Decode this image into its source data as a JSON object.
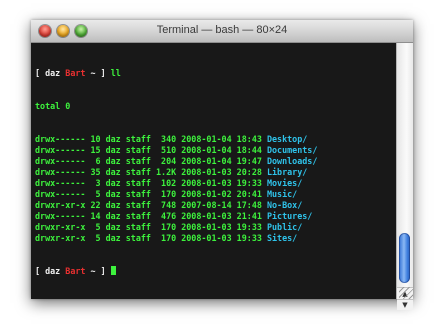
{
  "window": {
    "title": "Terminal — bash — 80×24"
  },
  "prompt": {
    "open": "[",
    "user": "daz",
    "host": "Bart",
    "path": "~",
    "close": "]"
  },
  "command": "ll",
  "total_line": "total 0",
  "listing": [
    {
      "perms": "drwx------",
      "links": "10",
      "user": "daz",
      "group": "staff",
      "size": "340",
      "date": "2008-01-04",
      "time": "18:43",
      "name": "Desktop/"
    },
    {
      "perms": "drwx------",
      "links": "15",
      "user": "daz",
      "group": "staff",
      "size": "510",
      "date": "2008-01-04",
      "time": "18:44",
      "name": "Documents/"
    },
    {
      "perms": "drwx------",
      "links": "6",
      "user": "daz",
      "group": "staff",
      "size": "204",
      "date": "2008-01-04",
      "time": "19:47",
      "name": "Downloads/"
    },
    {
      "perms": "drwx------",
      "links": "35",
      "user": "daz",
      "group": "staff",
      "size": "1.2K",
      "date": "2008-01-03",
      "time": "20:28",
      "name": "Library/"
    },
    {
      "perms": "drwx------",
      "links": "3",
      "user": "daz",
      "group": "staff",
      "size": "102",
      "date": "2008-01-03",
      "time": "19:33",
      "name": "Movies/"
    },
    {
      "perms": "drwx------",
      "links": "5",
      "user": "daz",
      "group": "staff",
      "size": "170",
      "date": "2008-01-02",
      "time": "20:41",
      "name": "Music/"
    },
    {
      "perms": "drwxr-xr-x",
      "links": "22",
      "user": "daz",
      "group": "staff",
      "size": "748",
      "date": "2007-08-14",
      "time": "17:48",
      "name": "No-Box/"
    },
    {
      "perms": "drwx------",
      "links": "14",
      "user": "daz",
      "group": "staff",
      "size": "476",
      "date": "2008-01-03",
      "time": "21:41",
      "name": "Pictures/"
    },
    {
      "perms": "drwxr-xr-x",
      "links": "5",
      "user": "daz",
      "group": "staff",
      "size": "170",
      "date": "2008-01-03",
      "time": "19:33",
      "name": "Public/"
    },
    {
      "perms": "drwxr-xr-x",
      "links": "5",
      "user": "daz",
      "group": "staff",
      "size": "170",
      "date": "2008-01-03",
      "time": "19:33",
      "name": "Sites/"
    }
  ],
  "colors": {
    "text": "#3df23d",
    "directory": "#2fc3ea",
    "host": "#e83030",
    "background": "#181818"
  },
  "icons": {
    "close": "close-icon",
    "minimize": "minimize-icon",
    "zoom": "zoom-icon",
    "scroll_up": "arrow-up-icon",
    "scroll_down": "arrow-down-icon"
  }
}
